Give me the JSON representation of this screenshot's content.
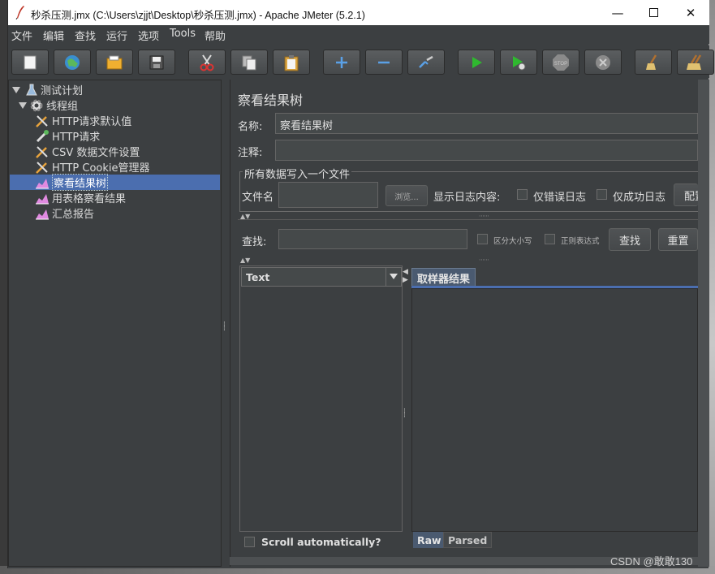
{
  "window": {
    "title": "秒杀压测.jmx (C:\\Users\\zjjt\\Desktop\\秒杀压测.jmx) - Apache JMeter (5.2.1)",
    "minimize": "—",
    "maximize": "☐",
    "close": "✕"
  },
  "menu": [
    "文件",
    "编辑",
    "查找",
    "运行",
    "选项",
    "Tools",
    "帮助"
  ],
  "toolbar": [
    "new-icon",
    "templates-icon",
    "open-icon",
    "save-icon",
    "cut-icon",
    "copy-icon",
    "paste-icon",
    "expand-icon",
    "collapse-icon",
    "toggle-icon",
    "start-icon",
    "start-no-pause-icon",
    "stop-icon",
    "shutdown-icon",
    "clear-icon",
    "clear-all-icon"
  ],
  "tree": {
    "test_plan": "测试计划",
    "thread_group": "线程组",
    "items": [
      "HTTP请求默认值",
      "HTTP请求",
      "CSV 数据文件设置",
      "HTTP Cookie管理器",
      "察看结果树",
      "用表格察看结果",
      "汇总报告"
    ]
  },
  "panel": {
    "title": "察看结果树",
    "name_label": "名称:",
    "name_value": "察看结果树",
    "comment_label": "注释:",
    "comment_value": "",
    "file_group_label": "所有数据写入一个文件",
    "filename_label": "文件名",
    "filename_value": "",
    "browse_button": "浏览...",
    "log_content_label": "显示日志内容:",
    "errors_only": "仅错误日志",
    "success_only": "仅成功日志",
    "configure_button": "配置",
    "search_label": "查找:",
    "search_value": "",
    "case_sensitive": "区分大小写",
    "regex": "正则表达式",
    "find_button": "查找",
    "reset_button": "重置",
    "renderer_value": "Text",
    "sampler_tab": "取样器结果",
    "scroll_auto": "Scroll automatically?",
    "raw_tab": "Raw",
    "parsed_tab": "Parsed"
  },
  "watermark": "CSDN @敢敢130",
  "colors": {
    "background": "#3c3f41",
    "selection": "#4b6eaf",
    "field": "#45494a"
  }
}
